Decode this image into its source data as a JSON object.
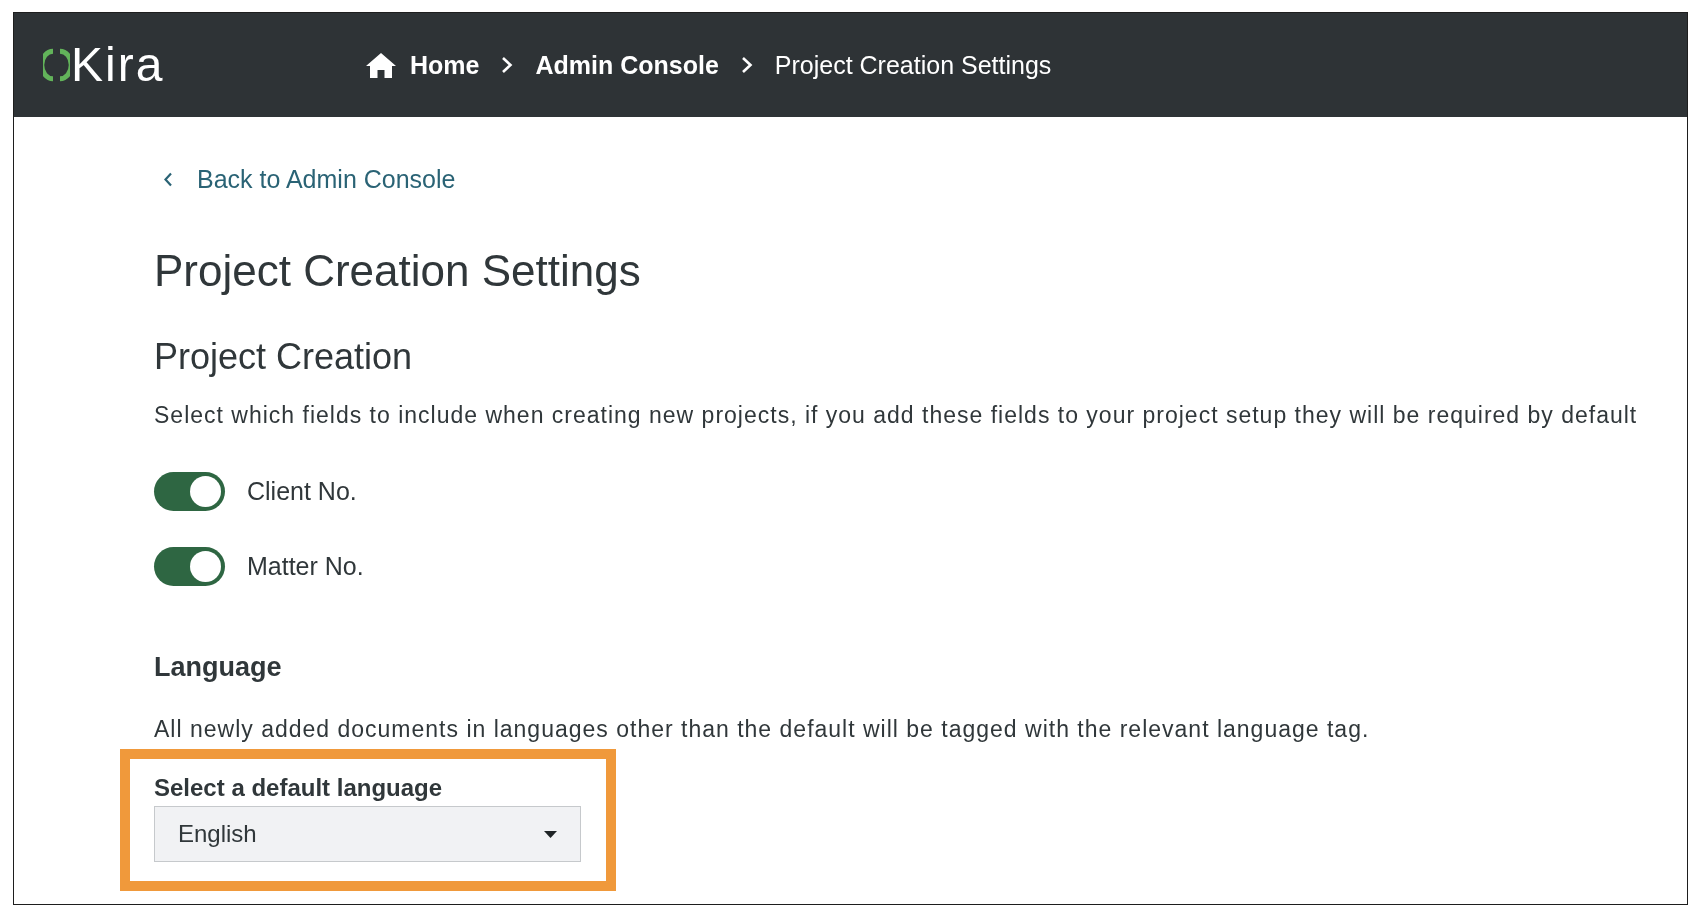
{
  "header": {
    "logo": "Kira",
    "breadcrumb": [
      {
        "label": "Home",
        "kind": "home"
      },
      {
        "label": "Admin Console",
        "kind": "link"
      },
      {
        "label": "Project Creation Settings",
        "kind": "current"
      }
    ]
  },
  "back_link": "Back to Admin Console",
  "title": "Project Creation Settings",
  "project_creation": {
    "heading": "Project Creation",
    "description": "Select which fields to include when creating new projects, if you add these fields to your project setup they will be required by default",
    "fields": [
      {
        "label": "Client No.",
        "on": true
      },
      {
        "label": "Matter No.",
        "on": true
      }
    ]
  },
  "language": {
    "heading": "Language",
    "description": "All newly added documents in languages other than the default will be tagged with the relevant language tag.",
    "select": {
      "label": "Select a default language",
      "value": "English",
      "highlighted": true
    }
  }
}
